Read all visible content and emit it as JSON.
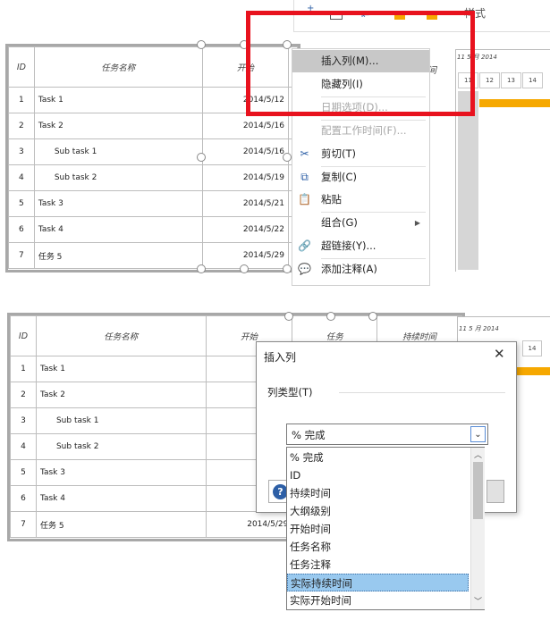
{
  "top_table": {
    "headers": [
      "ID",
      "任务名称",
      "开始"
    ],
    "rows": [
      {
        "id": "1",
        "name": "Task 1",
        "start": "2014/5/12",
        "bold": false,
        "indent": false
      },
      {
        "id": "2",
        "name": "Task 2",
        "start": "2014/5/16",
        "bold": true,
        "indent": false
      },
      {
        "id": "3",
        "name": "Sub task 1",
        "start": "2014/5/16",
        "bold": false,
        "indent": true
      },
      {
        "id": "4",
        "name": "Sub task 2",
        "start": "2014/5/19",
        "bold": false,
        "indent": true
      },
      {
        "id": "5",
        "name": "Task 3",
        "start": "2014/5/21",
        "bold": false,
        "indent": false
      },
      {
        "id": "6",
        "name": "Task 4",
        "start": "2014/5/22",
        "bold": false,
        "indent": false
      },
      {
        "id": "7",
        "name": "任务 5",
        "start": "2014/5/29",
        "bold": false,
        "indent": false
      }
    ],
    "partial_header": "间"
  },
  "gantt_top": {
    "month": "11 5 月 2014",
    "days": [
      "11",
      "12",
      "13",
      "14"
    ]
  },
  "toolbar_style_label": "样式",
  "context_menu": {
    "items": [
      {
        "label": "插入列(M)...",
        "selected": true,
        "disabled": false,
        "icon": ""
      },
      {
        "label": "隐藏列(I)",
        "selected": false,
        "disabled": false,
        "icon": ""
      },
      {
        "label": "日期选项(D)...",
        "selected": false,
        "disabled": true,
        "icon": ""
      },
      {
        "label": "配置工作时间(F)...",
        "selected": false,
        "disabled": true,
        "icon": ""
      },
      {
        "label": "剪切(T)",
        "selected": false,
        "disabled": false,
        "icon": "scissors-icon"
      },
      {
        "label": "复制(C)",
        "selected": false,
        "disabled": false,
        "icon": "copy-icon"
      },
      {
        "label": "粘贴",
        "selected": false,
        "disabled": false,
        "icon": "paste-icon"
      },
      {
        "label": "组合(G)",
        "selected": false,
        "disabled": false,
        "icon": ""
      },
      {
        "label": "超链接(Y)...",
        "selected": false,
        "disabled": false,
        "icon": "hyperlink-icon"
      },
      {
        "label": "添加注释(A)",
        "selected": false,
        "disabled": false,
        "icon": "comment-icon"
      }
    ]
  },
  "bottom_table": {
    "headers": [
      "ID",
      "任务名称",
      "开始",
      "任务",
      "持续时间"
    ],
    "rows": [
      {
        "id": "1",
        "name": "Task 1",
        "start": "2014/5/",
        "bold": false,
        "indent": false
      },
      {
        "id": "2",
        "name": "Task 2",
        "start": "2014/5/",
        "bold": true,
        "indent": false
      },
      {
        "id": "3",
        "name": "Sub task 1",
        "start": "2014/5/",
        "bold": false,
        "indent": true
      },
      {
        "id": "4",
        "name": "Sub task 2",
        "start": "2014/5/",
        "bold": false,
        "indent": true
      },
      {
        "id": "5",
        "name": "Task 3",
        "start": "2014/5/",
        "bold": false,
        "indent": false
      },
      {
        "id": "6",
        "name": "Task 4",
        "start": "2014/5/",
        "bold": false,
        "indent": false
      },
      {
        "id": "7",
        "name": "任务 5",
        "start": "2014/5/29",
        "bold": false,
        "indent": false
      }
    ]
  },
  "gantt_bottom": {
    "month": "11 5 月 2014",
    "days": [
      "14"
    ]
  },
  "dialog": {
    "title": "插入列",
    "column_type_label": "列类型(T)",
    "selected_value": "% 完成",
    "options": [
      "% 完成",
      "ID",
      "持续时间",
      "大纲级别",
      "开始时间",
      "任务名称",
      "任务注释",
      "实际持续时间",
      "实际开始时间"
    ],
    "highlighted_index": 7
  },
  "colors": {
    "highlight_box": "#e8121e",
    "gantt_bar": "#f6a800",
    "list_highlight": "#99c9ef",
    "menu_selected": "#c8c8c8"
  }
}
